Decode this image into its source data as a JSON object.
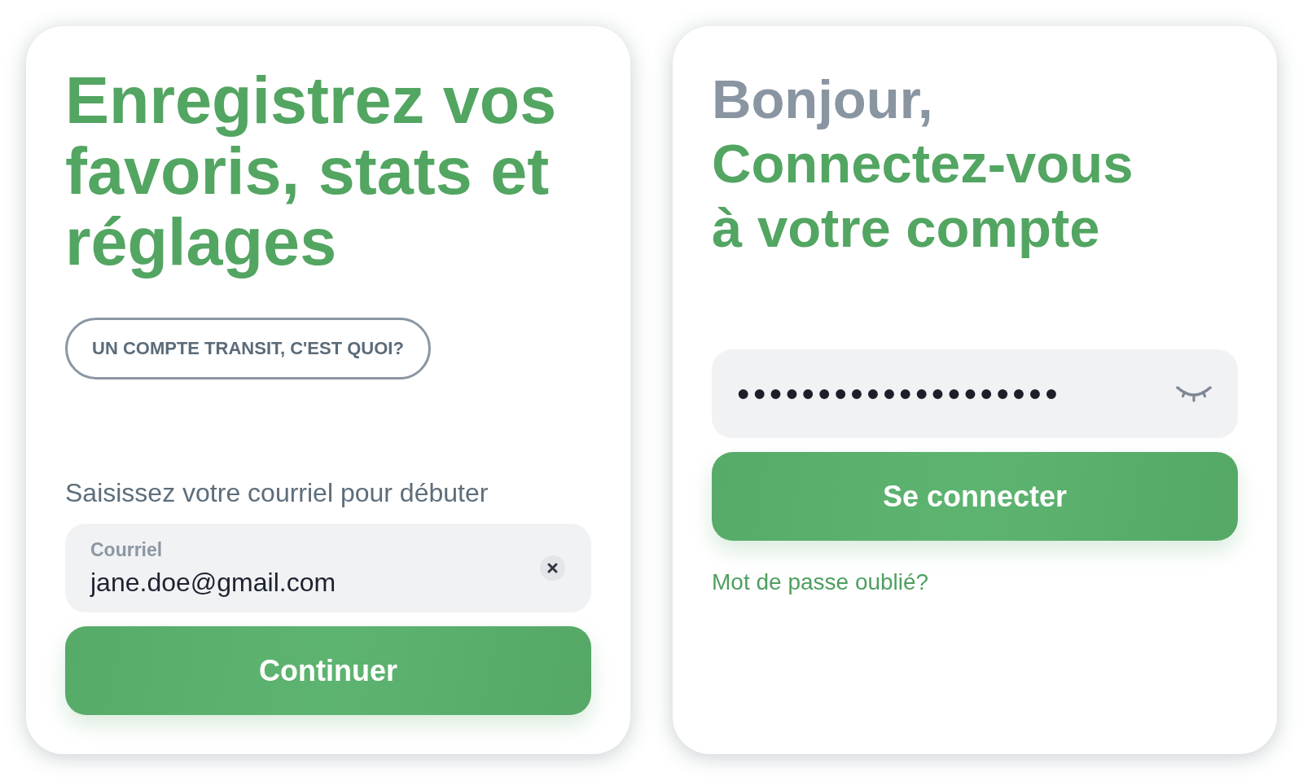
{
  "signup_card": {
    "title": "Enregistrez vos favoris, stats et réglages",
    "info_button": "UN COMPTE TRANSIT, C'EST QUOI?",
    "prompt": "Saisissez votre courriel pour débuter",
    "email_field": {
      "label": "Courriel",
      "value": "jane.doe@gmail.com"
    },
    "submit_button": "Continuer"
  },
  "login_card": {
    "greeting": "Bonjour,",
    "title": "Connectez-vous à votre compte",
    "password_field": {
      "value": "••••••••••••••••••••",
      "visible": false
    },
    "submit_button": "Se connecter",
    "forgot_password_link": "Mot de passe oublié?"
  }
}
